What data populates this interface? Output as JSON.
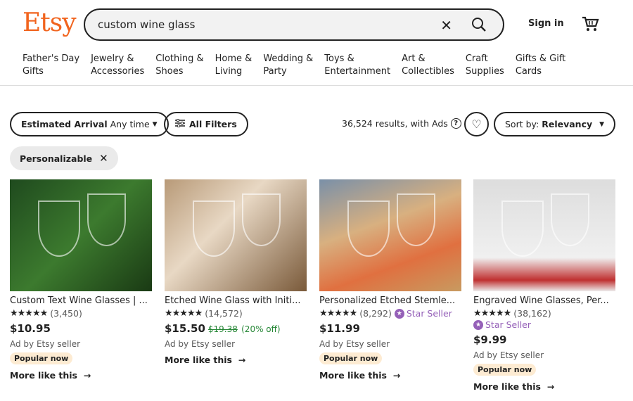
{
  "header": {
    "logo": "Etsy",
    "search_value": "custom wine glass",
    "sign_in": "Sign in"
  },
  "nav": [
    [
      "Father's Day",
      "Gifts"
    ],
    [
      "Jewelry &",
      "Accessories"
    ],
    [
      "Clothing &",
      "Shoes"
    ],
    [
      "Home &",
      "Living"
    ],
    [
      "Wedding &",
      "Party"
    ],
    [
      "Toys &",
      "Entertainment"
    ],
    [
      "Art &",
      "Collectibles"
    ],
    [
      "Craft",
      "Supplies"
    ],
    [
      "Gifts & Gift",
      "Cards"
    ]
  ],
  "filters": {
    "arrival_label": "Estimated Arrival",
    "arrival_value": "Any time",
    "all_filters": "All Filters",
    "results": "36,524 results, with Ads",
    "sort_label": "Sort by:",
    "sort_value": "Relevancy",
    "chip": "Personalizable"
  },
  "colors": {
    "brand": "#F1641E",
    "star_seller": "#9560b8",
    "sale": "#258635"
  },
  "listings": [
    {
      "title": "Custom Text Wine Glasses | ...",
      "stars": "★★★★★",
      "count": "(3,450)",
      "price": "$10.95",
      "ad": "Ad by Etsy seller",
      "badge": "Popular now",
      "more": "More like this"
    },
    {
      "title": "Etched Wine Glass with Initi...",
      "stars": "★★★★★",
      "count": "(14,572)",
      "price": "$15.50",
      "original_price": "$19.38",
      "discount": "(20% off)",
      "ad": "Ad by Etsy seller",
      "more": "More like this"
    },
    {
      "title": "Personalized Etched Stemle...",
      "stars": "★★★★★",
      "count": "(8,292)",
      "star_seller": "Star Seller",
      "price": "$11.99",
      "ad": "Ad by Etsy seller",
      "badge": "Popular now",
      "more": "More like this"
    },
    {
      "title": "Engraved Wine Glasses, Per...",
      "stars": "★★★★★",
      "count": "(38,162)",
      "star_seller": "Star Seller",
      "price": "$9.99",
      "ad": "Ad by Etsy seller",
      "badge": "Popular now",
      "more": "More like this"
    }
  ]
}
